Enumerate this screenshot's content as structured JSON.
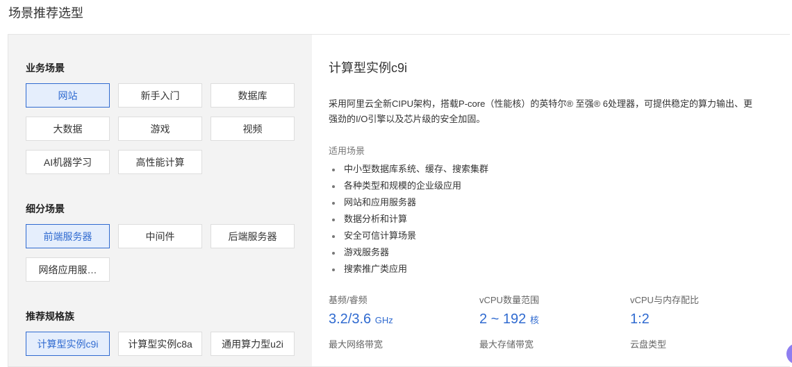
{
  "page_title": "场景推荐选型",
  "business": {
    "label": "业务场景",
    "items": [
      "网站",
      "新手入门",
      "数据库",
      "大数据",
      "游戏",
      "视频",
      "AI机器学习",
      "高性能计算"
    ],
    "selected": 0
  },
  "sub": {
    "label": "细分场景",
    "items": [
      "前端服务器",
      "中间件",
      "后端服务器",
      "网络应用服…"
    ],
    "selected": 0
  },
  "family": {
    "label": "推荐规格族",
    "items": [
      "计算型实例c9i",
      "计算型实例c8a",
      "通用算力型u2i"
    ],
    "selected": 0
  },
  "detail": {
    "title": "计算型实例c9i",
    "description": "采用阿里云全新CIPU架构，搭载P-core（性能核）的英特尔® 至强® 6处理器，可提供稳定的算力输出、更强劲的I/O引擎以及芯片级的安全加固。",
    "scenarios_label": "适用场景",
    "scenarios": [
      "中小型数据库系统、缓存、搜索集群",
      "各种类型和规模的企业级应用",
      "网站和应用服务器",
      "数据分析和计算",
      "安全可信计算场景",
      "游戏服务器",
      "搜索推广类应用"
    ],
    "specs": [
      {
        "label": "基频/睿频",
        "value": "3.2/3.6",
        "unit": "GHz"
      },
      {
        "label": "vCPU数量范围",
        "value": "2 ~ 192",
        "unit": "核"
      },
      {
        "label": "vCPU与内存配比",
        "value": "1:2",
        "unit": ""
      },
      {
        "label": "最大网络带宽"
      },
      {
        "label": "最大存储带宽"
      },
      {
        "label": "云盘类型"
      }
    ]
  }
}
